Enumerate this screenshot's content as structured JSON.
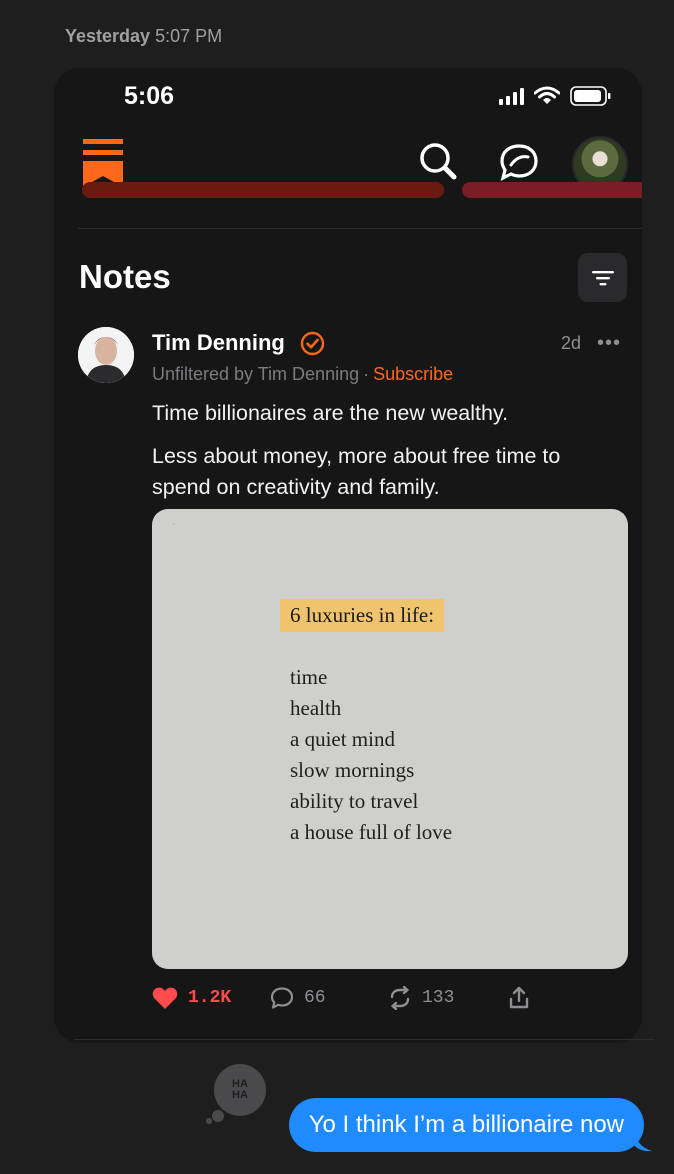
{
  "conversation": {
    "timestamp_day": "Yesterday",
    "timestamp_time": "5:07 PM",
    "reaction": "HA HA",
    "message": "Yo I think I’m a billionaire now"
  },
  "status_bar": {
    "time": "5:06"
  },
  "app": {
    "section_title": "Notes",
    "icons": [
      "substack-logo-icon",
      "search-icon",
      "chat-bubble-icon",
      "profile-avatar",
      "filter-icon"
    ],
    "accent_color": "#ff6719"
  },
  "post": {
    "author": "Tim Denning",
    "age": "2d",
    "more": "•••",
    "publication": "Unfiltered by Tim Denning",
    "separator": "·",
    "subscribe": "Subscribe",
    "paragraph_1": "Time billionaires are the new wealthy.",
    "paragraph_2": "Less about money, more about free time to spend on creativity and family.",
    "image": {
      "heading": "6 luxuries in life:",
      "items": [
        "time",
        "health",
        "a quiet mind",
        "slow mornings",
        "ability to travel",
        "a house full of love"
      ]
    },
    "likes": "1.2K",
    "comments": "66",
    "restacks": "133"
  }
}
